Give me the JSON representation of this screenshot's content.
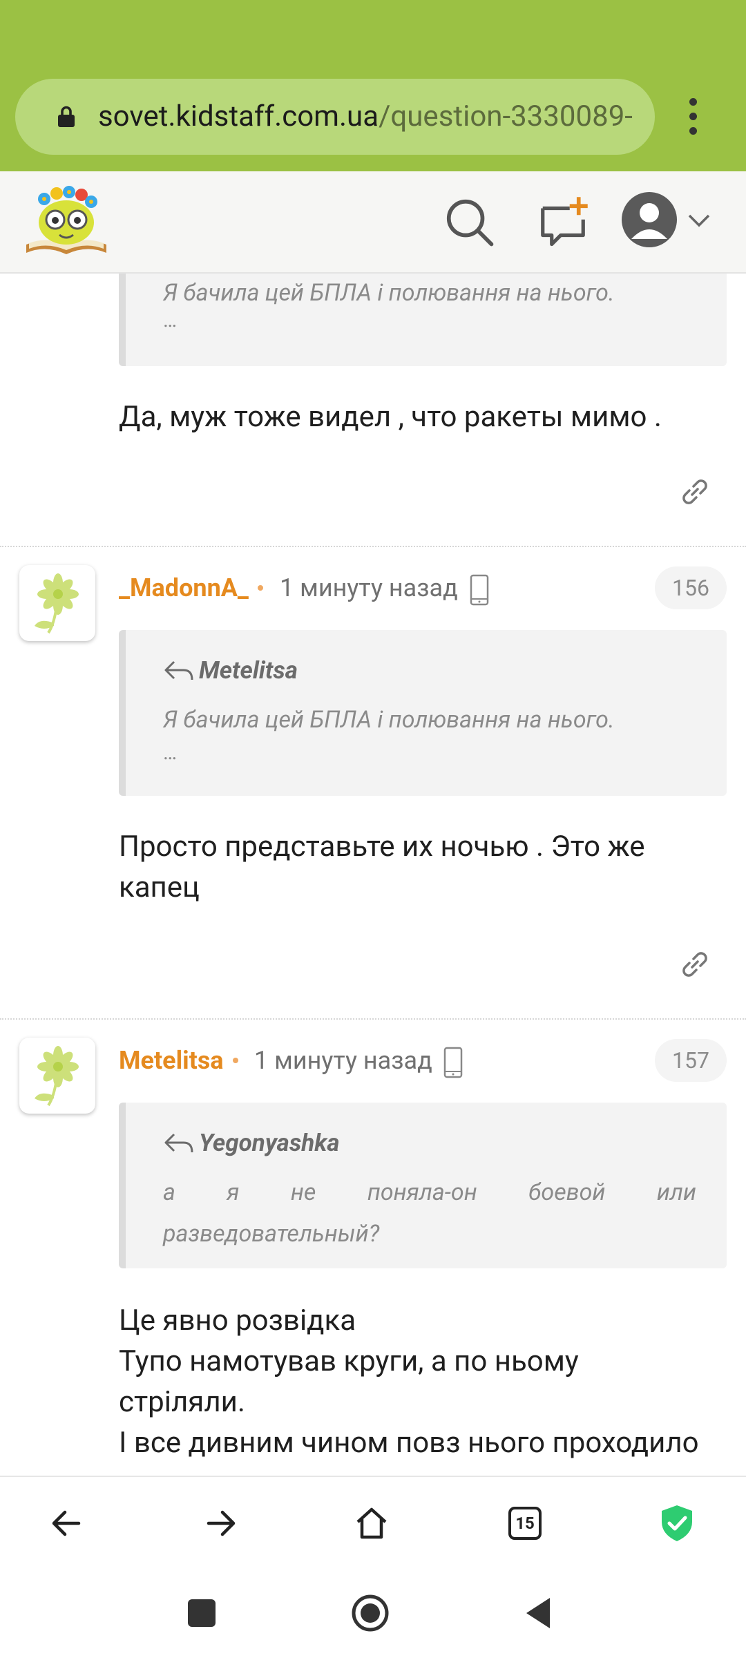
{
  "browser": {
    "url_host": "sovet.kidstaff.com.ua",
    "url_path": "/question-3330089-",
    "tab_count": "15"
  },
  "posts": [
    {
      "quote_text": "Я бачила цей БПЛА і полювання на нього.",
      "quote_ellipsis": "…",
      "body": "Да, муж тоже видел , что ракеты мимо ."
    },
    {
      "username": "_MadonnA_",
      "timestamp": "1 минуту назад",
      "number": "156",
      "quote_author": "Metelitsa",
      "quote_text": "Я бачила цей БПЛА і полювання на нього.",
      "quote_ellipsis": "…",
      "body_line1": "Просто представьте их ночью . Это же",
      "body_line2": "капец"
    },
    {
      "username": "Metelitsa",
      "timestamp": "1 минуту назад",
      "number": "157",
      "quote_author": "Yegonyashka",
      "quote_text_line1": "а я не поняла-он боевой или",
      "quote_text_line2": "разведовательный?",
      "body_line1": "Це явно розвідка",
      "body_line2": "Тупо намотував круги, а по ньому",
      "body_line3": "стріляли.",
      "body_line4": "І все дивним чином повз нього проходило"
    }
  ],
  "colors": {
    "browser_bar": "#9bc144",
    "username": "#e58a1f",
    "shield": "#2ecc71"
  },
  "icons": [
    "lock-icon",
    "menu-icon",
    "search-icon",
    "new-question-icon",
    "user-icon",
    "chevron-down-icon",
    "reply-icon",
    "phone-icon",
    "link-icon",
    "back-arrow-icon",
    "forward-arrow-icon",
    "home-icon",
    "tabs-icon",
    "shield-icon",
    "recents-icon",
    "home-circle-icon",
    "back-triangle-icon"
  ]
}
